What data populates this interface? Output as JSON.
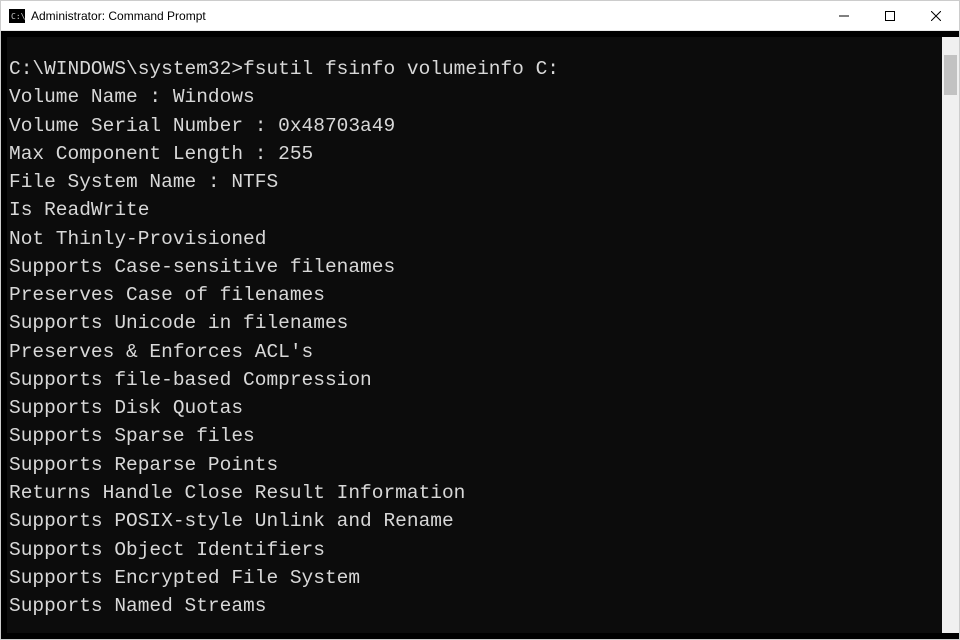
{
  "window": {
    "title": "Administrator: Command Prompt"
  },
  "terminal": {
    "prompt_path": "C:\\WINDOWS\\system32>",
    "command": "fsutil fsinfo volumeinfo C:",
    "output_lines": [
      "Volume Name : Windows",
      "Volume Serial Number : 0x48703a49",
      "Max Component Length : 255",
      "File System Name : NTFS",
      "Is ReadWrite",
      "Not Thinly-Provisioned",
      "Supports Case-sensitive filenames",
      "Preserves Case of filenames",
      "Supports Unicode in filenames",
      "Preserves & Enforces ACL's",
      "Supports file-based Compression",
      "Supports Disk Quotas",
      "Supports Sparse files",
      "Supports Reparse Points",
      "Returns Handle Close Result Information",
      "Supports POSIX-style Unlink and Rename",
      "Supports Object Identifiers",
      "Supports Encrypted File System",
      "Supports Named Streams"
    ]
  }
}
